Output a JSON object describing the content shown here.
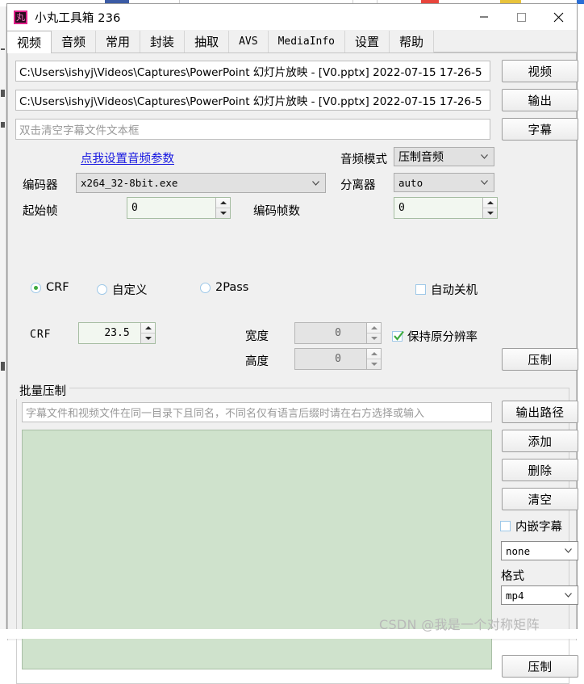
{
  "window": {
    "title": "小丸工具箱 236",
    "icon": "丸",
    "minimize_label": "—",
    "maximize_label": "□",
    "close_label": "✕"
  },
  "tabs": [
    {
      "label": "视频",
      "active": true,
      "mono": false
    },
    {
      "label": "音频",
      "active": false,
      "mono": false
    },
    {
      "label": "常用",
      "active": false,
      "mono": false
    },
    {
      "label": "封装",
      "active": false,
      "mono": false
    },
    {
      "label": "抽取",
      "active": false,
      "mono": false
    },
    {
      "label": "AVS",
      "active": false,
      "mono": true
    },
    {
      "label": "MediaInfo",
      "active": false,
      "mono": true
    },
    {
      "label": "设置",
      "active": false,
      "mono": false
    },
    {
      "label": "帮助",
      "active": false,
      "mono": false
    }
  ],
  "file_rows": [
    {
      "value": "C:\\Users\\ishyj\\Videos\\Captures\\PowerPoint 幻灯片放映 - [V0.pptx] 2022-07-15 17-26-5",
      "placeholder": "",
      "button": "视频",
      "is_placeholder": false
    },
    {
      "value": "C:\\Users\\ishyj\\Videos\\Captures\\PowerPoint 幻灯片放映 - [V0.pptx] 2022-07-15 17-26-5",
      "placeholder": "",
      "button": "输出",
      "is_placeholder": false
    },
    {
      "value": "双击清空字幕文件文本框",
      "placeholder": "双击清空字幕文件文本框",
      "button": "字幕",
      "is_placeholder": true
    }
  ],
  "audio": {
    "settings_link": "点我设置音频参数",
    "mode_label": "音频模式",
    "mode_value": "压制音频",
    "demux_label": "分离器",
    "demux_value": "auto"
  },
  "encoder": {
    "label": "编码器",
    "value": "x264_32-8bit.exe"
  },
  "frames": {
    "start_label": "起始帧",
    "start_value": "0",
    "count_label": "编码帧数",
    "count_value": "0"
  },
  "modes": {
    "radios": [
      {
        "label": "CRF",
        "selected": true
      },
      {
        "label": "自定义",
        "selected": false
      },
      {
        "label": "2Pass",
        "selected": false
      }
    ],
    "auto_shutdown_label": "自动关机",
    "auto_shutdown_checked": false
  },
  "quality": {
    "crf_label": "CRF",
    "crf_value": "23.5",
    "width_label": "宽度",
    "width_value": "0",
    "height_label": "高度",
    "height_value": "0",
    "keep_resolution_label": "保持原分辨率",
    "keep_resolution_checked": true,
    "compress_button": "压制"
  },
  "batch": {
    "group_title": "批量压制",
    "hint_placeholder": "字幕文件和视频文件在同一目录下且同名，不同名仅有语言后缀时请在右方选择或输入",
    "buttons": [
      {
        "label": "输出路径",
        "name": "output-path-button"
      },
      {
        "label": "添加",
        "name": "add-button"
      },
      {
        "label": "删除",
        "name": "delete-button"
      },
      {
        "label": "清空",
        "name": "clear-button"
      }
    ],
    "embed_subtitle_label": "内嵌字幕",
    "embed_subtitle_checked": false,
    "subtitle_lang_value": "none",
    "format_label": "格式",
    "format_value": "mp4",
    "compress_button": "压制"
  },
  "watermark": "CSDN @我是一个对称矩阵",
  "colors": {
    "accent_link": "#1414e0",
    "list_bg": "#cfe2cc",
    "check_green": "#3faa3f",
    "icon_magenta": "#e0218a"
  }
}
